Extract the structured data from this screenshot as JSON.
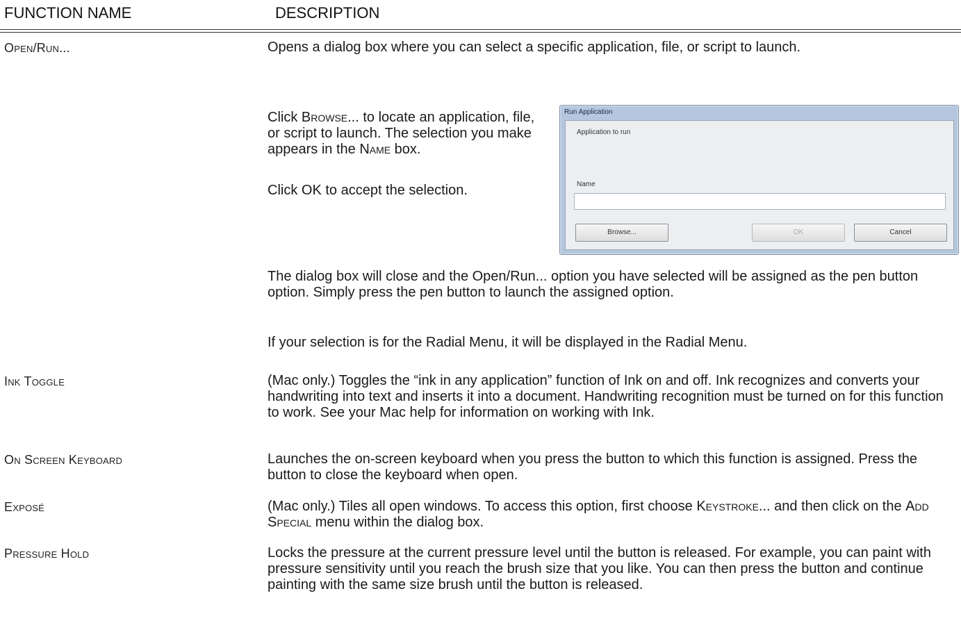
{
  "header": {
    "col1": "FUNCTION NAME",
    "col2": "DESCRIPTION"
  },
  "rows": [
    {
      "name": "Open/Run...",
      "paragraphs": [
        "Opens a dialog box where you can select a specific application, file, or script to launch.",
        "The dialog box will close and the Open/Run... option you have selected will be assigned as the pen button option. Simply press the pen button to launch the assigned option.",
        "If your selection is for the Radial Menu, it will be displayed in the Radial Menu."
      ],
      "side_text": {
        "p1_a": "Click ",
        "p1_sc1": "Browse",
        "p1_b": "... to locate an application, file, or script to launch. The selection you make appears in the ",
        "p1_sc2": "Name",
        "p1_c": " box.",
        "p2": "Click OK to accept the selection."
      }
    },
    {
      "name": "Ink Toggle",
      "text": "(Mac only.) Toggles the “ink in any application” function of Ink on and off. Ink recognizes and converts your handwriting into text and inserts it into a document. Handwriting recognition must be turned on for this function to work. See your Mac help for information on working with Ink."
    },
    {
      "name": "On Screen Keyboard",
      "text": "Launches the on-screen keyboard when you press the button to which this function is assigned. Press the button to close the keyboard when open."
    },
    {
      "name": "Exposé",
      "text_a": "(Mac only.) Tiles all open windows. To access this option, first choose ",
      "text_sc1": "Keystroke...",
      "text_b": " and then click on the ",
      "text_sc2": "Add Special",
      "text_c": " menu within the dialog box."
    },
    {
      "name": "Pressure Hold",
      "text": "Locks the pressure at the current pressure level until the button is released. For example, you can paint with pressure sensitivity until you reach the brush size that you like. You can then press the button and continue painting with the same size brush until the button is released."
    }
  ],
  "dialog": {
    "title": "Run Application",
    "label_app": "Application to run",
    "label_name": "Name",
    "name_value": "",
    "browse_label": "Browse...",
    "ok_label": "OK",
    "cancel_label": "Cancel"
  }
}
